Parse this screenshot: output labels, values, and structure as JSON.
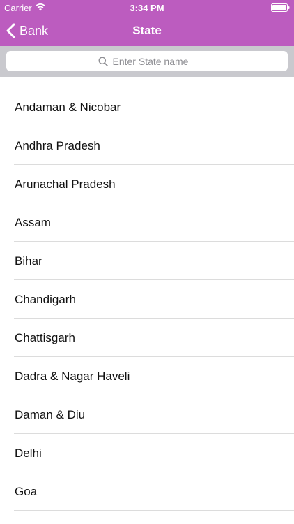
{
  "status_bar": {
    "carrier": "Carrier",
    "time": "3:34 PM"
  },
  "nav": {
    "back_label": "Bank",
    "title": "State"
  },
  "search": {
    "placeholder": "Enter State name",
    "value": ""
  },
  "states": [
    "Andaman & Nicobar",
    "Andhra Pradesh",
    "Arunachal Pradesh",
    "Assam",
    "Bihar",
    "Chandigarh",
    "Chattisgarh",
    "Dadra & Nagar Haveli",
    "Daman & Diu",
    "Delhi",
    "Goa"
  ],
  "colors": {
    "header": "#bc5cbf",
    "search_bar": "#c9c9ce",
    "separator": "#dcdcdc"
  },
  "icons": {
    "wifi": "wifi-icon",
    "battery": "battery-icon",
    "back": "chevron-left-icon",
    "search": "search-icon"
  }
}
